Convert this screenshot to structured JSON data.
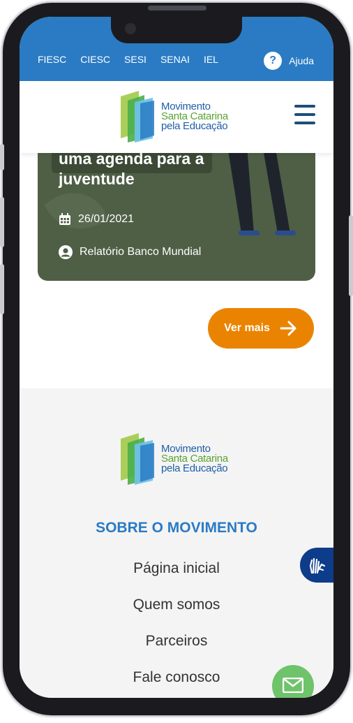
{
  "topbar": {
    "links": [
      "FIESC",
      "CIESC",
      "SESI",
      "SENAI",
      "IEL"
    ],
    "help_label": "Ajuda",
    "help_icon": "?"
  },
  "logo": {
    "line1": "Movimento",
    "line2": "Santa Catarina",
    "line3": "pela Educação"
  },
  "card": {
    "title_line1": "uma agenda para a",
    "title_line2": "juventude",
    "date": "26/01/2021",
    "author": "Relatório Banco Mundial"
  },
  "ver_mais": {
    "label": "Ver mais"
  },
  "footer": {
    "section_title": "SOBRE O MOVIMENTO",
    "links": [
      "Página inicial",
      "Quem somos",
      "Parceiros",
      "Fale conosco"
    ]
  },
  "colors": {
    "topbar_bg": "#2a7bc4",
    "accent_orange": "#ea8400",
    "card_bg": "#4f5f46",
    "footer_bg": "#f4f4f4",
    "mail_green": "#6fc36b",
    "vlibras_blue": "#0d3c8a"
  }
}
